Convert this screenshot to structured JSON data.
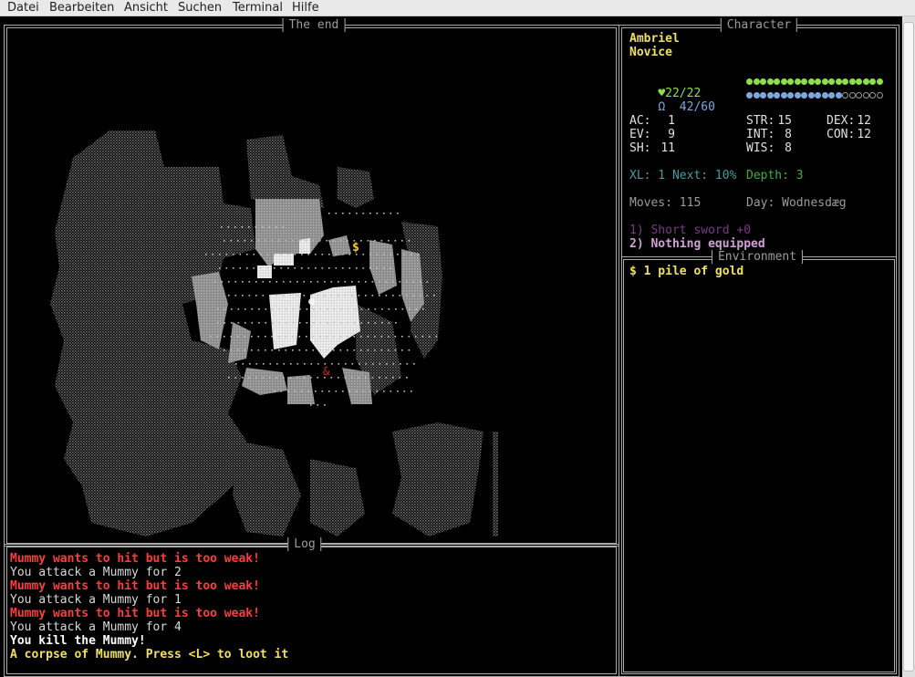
{
  "menu": [
    "Datei",
    "Bearbeiten",
    "Ansicht",
    "Suchen",
    "Terminal",
    "Hilfe"
  ],
  "panels": {
    "map_title": "The end",
    "character_title": "Character",
    "environment_title": "Environment",
    "log_title": "Log"
  },
  "character": {
    "name": "Ambriel",
    "rank": "Novice",
    "hp": {
      "symbol": "♥",
      "text": "22/22",
      "current": 22,
      "max": 22,
      "color": "#8ee04a"
    },
    "mp": {
      "symbol": "Ω",
      "text": "42/60",
      "current": 42,
      "max": 60,
      "color": "#7aa8e0"
    },
    "stats": [
      {
        "label": "AC:",
        "value": "1"
      },
      {
        "label": "STR:",
        "value": "15"
      },
      {
        "label": "DEX:",
        "value": "12"
      },
      {
        "label": "EV:",
        "value": "9"
      },
      {
        "label": "INT:",
        "value": "8"
      },
      {
        "label": "CON:",
        "value": "12"
      },
      {
        "label": "SH:",
        "value": "11"
      },
      {
        "label": "WIS:",
        "value": "8"
      }
    ],
    "xl": "XL: 1 Next: 10%",
    "depth": "Depth: 3",
    "moves": "Moves: 115",
    "day": "Day: Wodnesdæg",
    "equipment": [
      {
        "text": "1) Short sword +0",
        "color": "#7a3a8a"
      },
      {
        "text": "2) Nothing equipped",
        "color": "#d2a0d8"
      }
    ]
  },
  "environment": {
    "items": [
      "$ 1 pile of gold"
    ]
  },
  "map": {
    "gold_glyph": "$",
    "player_glyph": "☻",
    "corpse_glyph": "&",
    "colors": {
      "rock": "#7a7a7a",
      "wall": "#9a9a9a",
      "bright": "#f0f0f0",
      "floor": "#bdbdbd",
      "gold": "#f0d020",
      "player": "#ffffff",
      "corpse": "#d03020"
    }
  },
  "log": [
    {
      "text": "Mummy wants to hit but is too weak!",
      "color": "#ff3c3c",
      "bold": true
    },
    {
      "text": "You attack a Mummy for 2",
      "color": "#d8d8d8",
      "bold": false
    },
    {
      "text": "Mummy wants to hit but is too weak!",
      "color": "#ff3c3c",
      "bold": true
    },
    {
      "text": "You attack a Mummy for 1",
      "color": "#d8d8d8",
      "bold": false
    },
    {
      "text": "Mummy wants to hit but is too weak!",
      "color": "#ff3c3c",
      "bold": true
    },
    {
      "text": "You attack a Mummy for 4",
      "color": "#d8d8d8",
      "bold": false
    },
    {
      "text": "You kill the Mummy!",
      "color": "#ffffff",
      "bold": true
    },
    {
      "text": "A corpse of Mummy. Press <L> to loot it",
      "color": "#f0e060",
      "bold": true
    }
  ]
}
